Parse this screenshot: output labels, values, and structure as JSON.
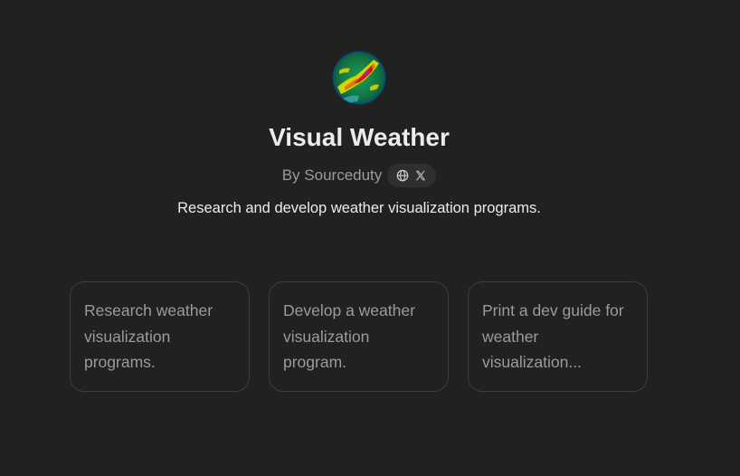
{
  "gpt": {
    "name": "Visual Weather",
    "author": "By Sourceduty",
    "description": "Research and develop weather visualization programs.",
    "avatar_icon": "weather-radar-map",
    "social_icons": [
      "globe-icon",
      "x-icon"
    ]
  },
  "starters": [
    {
      "label": "Research weather visualization programs."
    },
    {
      "label": "Develop a weather visualization program."
    },
    {
      "label": "Print a dev guide for weather visualization..."
    }
  ],
  "colors": {
    "background": "#212121",
    "title": "#ececec",
    "muted": "#9b9b9b",
    "card_border": "#3e3e3e"
  }
}
